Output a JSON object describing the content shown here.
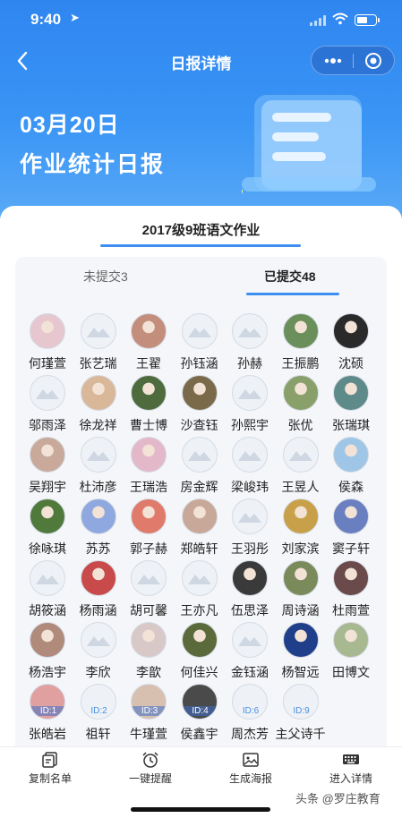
{
  "status_bar": {
    "time": "9:40",
    "location_glyph": "➤"
  },
  "nav": {
    "title": "日报详情",
    "back_icon": "chevron-left-icon",
    "more_icon": "more-dots-icon",
    "close_icon": "target-close-icon"
  },
  "hero": {
    "date": "03月20日",
    "title": "作业统计日报"
  },
  "class_title": "2017级9班语文作业",
  "tabs": [
    {
      "label": "未提交3",
      "active": false
    },
    {
      "label": "已提交48",
      "active": true
    }
  ],
  "students": [
    {
      "name": "何瑾萱",
      "avatar": "photo",
      "color": "#e6c7cf"
    },
    {
      "name": "张艺瑞",
      "avatar": "placeholder"
    },
    {
      "name": "王翟",
      "avatar": "photo",
      "color": "#c48e7c"
    },
    {
      "name": "孙钰涵",
      "avatar": "placeholder"
    },
    {
      "name": "孙赫",
      "avatar": "placeholder"
    },
    {
      "name": "王振鹏",
      "avatar": "photo",
      "color": "#6b8f5a"
    },
    {
      "name": "沈硕",
      "avatar": "photo",
      "color": "#2a2a2a"
    },
    {
      "name": "邬雨泽",
      "avatar": "placeholder"
    },
    {
      "name": "徐龙祥",
      "avatar": "photo",
      "color": "#d9b89a"
    },
    {
      "name": "曹士博",
      "avatar": "photo",
      "color": "#4d6b3c"
    },
    {
      "name": "沙查钰",
      "avatar": "photo",
      "color": "#7a6a4a"
    },
    {
      "name": "孙熙宇",
      "avatar": "placeholder"
    },
    {
      "name": "张优",
      "avatar": "photo",
      "color": "#8aa06a"
    },
    {
      "name": "张瑞琪",
      "avatar": "photo",
      "color": "#5f8a8a"
    },
    {
      "name": "吴翔宇",
      "avatar": "photo",
      "color": "#c9a99a"
    },
    {
      "name": "杜沛彦",
      "avatar": "placeholder"
    },
    {
      "name": "王瑞浩",
      "avatar": "photo",
      "color": "#e3b8c8"
    },
    {
      "name": "房金辉",
      "avatar": "placeholder"
    },
    {
      "name": "梁峻玮",
      "avatar": "placeholder"
    },
    {
      "name": "王昱人",
      "avatar": "placeholder"
    },
    {
      "name": "侯森",
      "avatar": "photo",
      "color": "#9fc6e6"
    },
    {
      "name": "徐咏琪",
      "avatar": "photo",
      "color": "#4f7a3c"
    },
    {
      "name": "苏苏",
      "avatar": "photo",
      "color": "#8fa8e0"
    },
    {
      "name": "郭子赫",
      "avatar": "photo",
      "color": "#e07a6a"
    },
    {
      "name": "郑皓轩",
      "avatar": "photo",
      "color": "#c8a898"
    },
    {
      "name": "王羽彤",
      "avatar": "placeholder"
    },
    {
      "name": "刘家滨",
      "avatar": "photo",
      "color": "#c9a04a"
    },
    {
      "name": "窦子轩",
      "avatar": "photo",
      "color": "#6a7fc0"
    },
    {
      "name": "胡筱涵",
      "avatar": "placeholder"
    },
    {
      "name": "杨雨涵",
      "avatar": "photo",
      "color": "#c84a4a"
    },
    {
      "name": "胡可馨",
      "avatar": "placeholder"
    },
    {
      "name": "王亦凡",
      "avatar": "placeholder"
    },
    {
      "name": "伍思泽",
      "avatar": "photo",
      "color": "#3a3a3a"
    },
    {
      "name": "周诗涵",
      "avatar": "photo",
      "color": "#7a8a5a"
    },
    {
      "name": "杜雨萱",
      "avatar": "photo",
      "color": "#6a4a4a"
    },
    {
      "name": "杨浩宇",
      "avatar": "photo",
      "color": "#b08a7a"
    },
    {
      "name": "李欣",
      "avatar": "placeholder"
    },
    {
      "name": "李歆",
      "avatar": "photo",
      "color": "#d8c8c8"
    },
    {
      "name": "何佳兴",
      "avatar": "photo",
      "color": "#5a6a3a"
    },
    {
      "name": "金钰涵",
      "avatar": "placeholder"
    },
    {
      "name": "杨智远",
      "avatar": "photo",
      "color": "#1f3f8a"
    },
    {
      "name": "田博文",
      "avatar": "photo",
      "color": "#a8b890"
    },
    {
      "name": "张皓岩",
      "avatar": "id",
      "id": "ID:1",
      "color": "#e0a0a0"
    },
    {
      "name": "祖轩",
      "avatar": "id",
      "id": "ID:2"
    },
    {
      "name": "牛瑾萱",
      "avatar": "id",
      "id": "ID:3",
      "color": "#d8c0b0"
    },
    {
      "name": "侯鑫宇",
      "avatar": "id",
      "id": "ID:4",
      "color": "#4a4a4a"
    },
    {
      "name": "周杰芳",
      "avatar": "id",
      "id": "ID:6"
    },
    {
      "name": "主父诗千",
      "avatar": "id",
      "id": "ID:9"
    }
  ],
  "bottom_bar": [
    {
      "label": "复制名单",
      "icon": "copy-list-icon"
    },
    {
      "label": "一键提醒",
      "icon": "alarm-clock-icon"
    },
    {
      "label": "生成海报",
      "icon": "image-poster-icon"
    },
    {
      "label": "进入详情",
      "icon": "keyboard-icon"
    }
  ],
  "watermark": "头条 @罗庄教育"
}
